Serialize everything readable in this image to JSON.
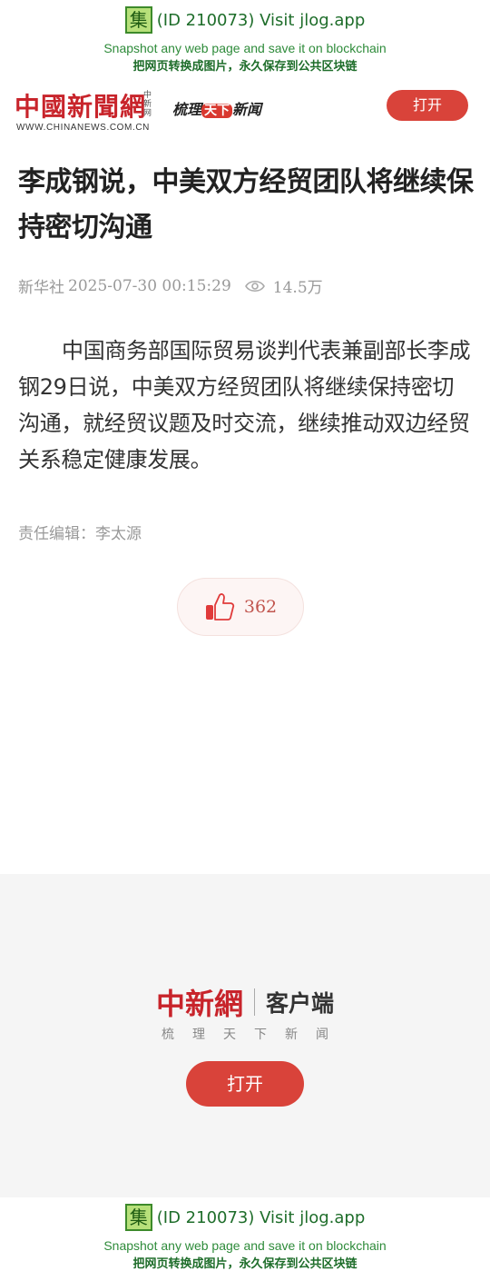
{
  "banner": {
    "icon_glyph": "集",
    "title": "(ID 210073) Visit jlog.app",
    "subtitle_en": "Snapshot any web page and save it on blockchain",
    "subtitle_cn": "把网页转换成图片，永久保存到公共区块链"
  },
  "header": {
    "logo_text": "中國新聞網",
    "logo_small": "中新网",
    "logo_url": "WWW.CHINANEWS.COM.CN",
    "slogan_prefix": "梳理",
    "slogan_mid": "天下",
    "slogan_suffix": "新闻",
    "open_label": "打开"
  },
  "article": {
    "title": "李成钢说，中美双方经贸团队将继续保持密切沟通",
    "source": "新华社",
    "datetime": "2025-07-30 00:15:29",
    "views": "14.5万",
    "body": "中国商务部国际贸易谈判代表兼副部长李成钢29日说，中美双方经贸团队将继续保持密切沟通，就经贸议题及时交流，继续推动双边经贸关系稳定健康发展。",
    "editor": "责任编辑：李太源",
    "likes": "362"
  },
  "promo": {
    "brand": "中新網",
    "app_label": "客户端",
    "slogan": "梳理天下新闻",
    "open_label": "打开"
  },
  "colors": {
    "brand_red": "#c8242b",
    "button_red": "#d9433a",
    "banner_green": "#1e6d2a"
  },
  "icons": {
    "views": "eye-icon",
    "like": "thumbs-up-icon"
  }
}
